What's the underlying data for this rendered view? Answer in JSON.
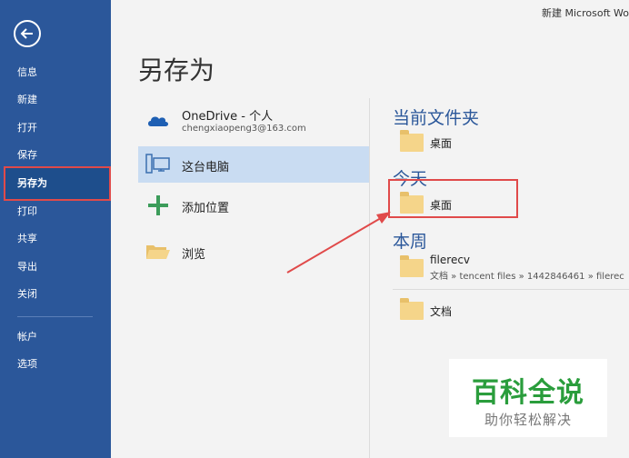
{
  "window": {
    "title": "新建 Microsoft Wo"
  },
  "sidebar": {
    "items": [
      {
        "label": "信息"
      },
      {
        "label": "新建"
      },
      {
        "label": "打开"
      },
      {
        "label": "保存"
      },
      {
        "label": "另存为"
      },
      {
        "label": "打印"
      },
      {
        "label": "共享"
      },
      {
        "label": "导出"
      },
      {
        "label": "关闭"
      },
      {
        "label": "帐户"
      },
      {
        "label": "选项"
      }
    ],
    "active_index": 4
  },
  "main": {
    "title": "另存为",
    "locations": [
      {
        "label": "OneDrive - 个人",
        "sub": "chengxiaopeng3@163.com",
        "icon": "cloud-icon"
      },
      {
        "label": "这台电脑",
        "icon": "computer-icon"
      },
      {
        "label": "添加位置",
        "icon": "plus-icon"
      },
      {
        "label": "浏览",
        "icon": "folder-open-icon"
      }
    ],
    "sections": {
      "current": {
        "title": "当前文件夹",
        "folders": [
          {
            "label": "桌面"
          }
        ]
      },
      "today": {
        "title": "今天",
        "folders": [
          {
            "label": "桌面"
          }
        ]
      },
      "week": {
        "title": "本周",
        "folders": [
          {
            "label": "filerecv",
            "path": "文档 » tencent files » 1442846461 » filerec"
          },
          {
            "label": "文档"
          }
        ]
      }
    }
  },
  "watermark": {
    "title": "百科全说",
    "subtitle": "助你轻松解决"
  },
  "colors": {
    "sidebar": "#2b579a",
    "accent": "#2b579a",
    "selected": "#c9dcf2",
    "annotation": "#e04a4a",
    "folder": "#f5d58a"
  }
}
